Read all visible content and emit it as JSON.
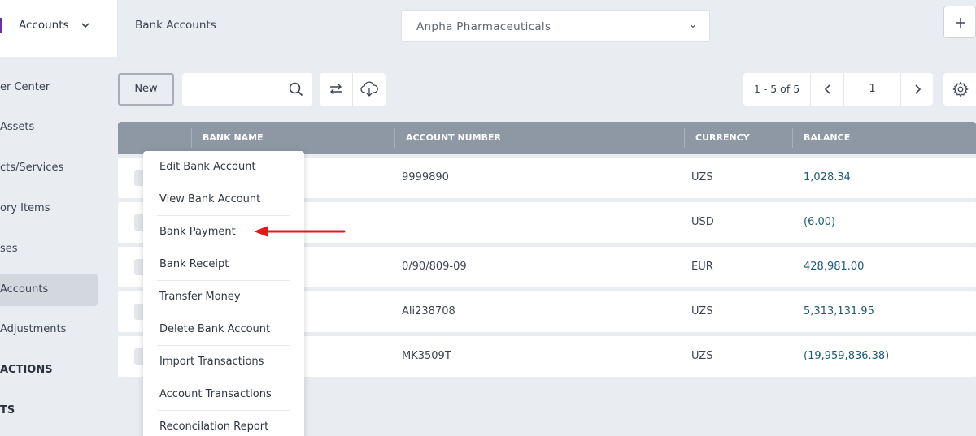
{
  "sidebar": {
    "header_label": "Accounts",
    "items": [
      {
        "label": "er Center",
        "active": false,
        "section": false
      },
      {
        "label": "Assets",
        "active": false,
        "section": false
      },
      {
        "label": "cts/Services",
        "active": false,
        "section": false
      },
      {
        "label": "ory Items",
        "active": false,
        "section": false
      },
      {
        "label": "ses",
        "active": false,
        "section": false
      },
      {
        "label": "Accounts",
        "active": true,
        "section": false
      },
      {
        "label": "Adjustments",
        "active": false,
        "section": false
      },
      {
        "label": "ACTIONS",
        "active": false,
        "section": true
      },
      {
        "label": "TS",
        "active": false,
        "section": true
      }
    ]
  },
  "header": {
    "page_title": "Bank Accounts",
    "company": "Anpha Pharmaceuticals",
    "add_label": "+"
  },
  "toolbar": {
    "new_label": "New",
    "search_value": "",
    "search_placeholder": "",
    "pagination": {
      "range": "1 - 5 of 5",
      "page": "1"
    }
  },
  "table": {
    "columns": [
      "BANK NAME",
      "ACCOUNT NUMBER",
      "CURRENCY",
      "BALANCE"
    ],
    "rows": [
      {
        "bank_name": "",
        "account_number": "9999890",
        "currency": "UZS",
        "balance": "1,028.34"
      },
      {
        "bank_name": "",
        "account_number": "",
        "currency": "USD",
        "balance": "(6.00)"
      },
      {
        "bank_name": "",
        "account_number": "0/90/809-09",
        "currency": "EUR",
        "balance": "428,981.00"
      },
      {
        "bank_name": "",
        "account_number": "Ali238708",
        "currency": "UZS",
        "balance": "5,313,131.95"
      },
      {
        "bank_name": "",
        "account_number": "MK3509T",
        "currency": "UZS",
        "balance": "(19,959,836.38)"
      }
    ]
  },
  "context_menu": {
    "items": [
      "Edit Bank Account",
      "View Bank Account",
      "Bank Payment",
      "Bank Receipt",
      "Transfer Money",
      "Delete Bank Account",
      "Import Transactions",
      "Account Transactions",
      "Reconcilation Report"
    ]
  },
  "colors": {
    "brand": "#6f2da8",
    "table_header": "#8e97a4",
    "balance_text": "#1e5a78",
    "annotation_arrow": "#e11b1b"
  },
  "icons": {
    "search": "search-icon",
    "swap": "swap-arrows-icon",
    "download": "cloud-download-icon",
    "prev": "chevron-left-icon",
    "next": "chevron-right-icon",
    "settings": "gear-icon",
    "dropdown": "chevron-down-icon"
  }
}
